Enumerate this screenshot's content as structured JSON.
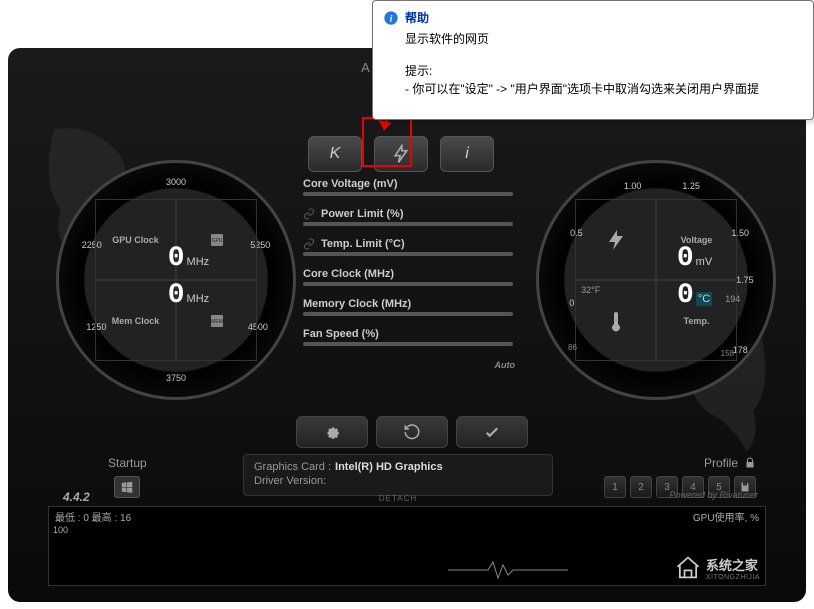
{
  "header": {
    "brand": "A F T E R"
  },
  "tooltip": {
    "title": "帮助",
    "desc": "显示软件的网页",
    "hint_label": "提示:",
    "hint_text": "- 你可以在\"设定\" -> \"用户界面\"选项卡中取消勾选来关闭用户界面提"
  },
  "tabs": {
    "k": "K",
    "i": "i"
  },
  "sliders": {
    "core_voltage": "Core Voltage (mV)",
    "power_limit": "Power Limit (%)",
    "temp_limit": "Temp. Limit (°C)",
    "core_clock": "Core Clock (MHz)",
    "memory_clock": "Memory Clock (MHz)",
    "fan_speed": "Fan Speed (%)",
    "auto": "Auto"
  },
  "gauge_left": {
    "ticks": [
      "1250",
      "2250",
      "3000",
      "3750",
      "4500",
      "5250"
    ],
    "q1_label": "GPU Clock",
    "q1_value": "0",
    "q1_unit": "MHz",
    "q3_label": "Mem Clock",
    "q3_value": "0",
    "q3_unit": "MHz",
    "q4_icon_label": "MEM"
  },
  "gauge_right": {
    "ticks": [
      "0",
      "0.5",
      "1.00",
      "1.25",
      "1.50",
      "1.75",
      "178"
    ],
    "q2_label": "Voltage",
    "q2_value": "0",
    "q2_unit": "mV",
    "q4_label": "Temp.",
    "q4_value": "0",
    "q4_unit": "°C",
    "temp_f": "32°F",
    "temp_sub1": "194",
    "temp_sub2": "158",
    "fan_rpm": "86"
  },
  "startup": {
    "label": "Startup"
  },
  "profile": {
    "label": "Profile",
    "buttons": [
      "1",
      "2",
      "3",
      "4",
      "5"
    ]
  },
  "info": {
    "card_label": "Graphics Card :",
    "card_value": "Intel(R) HD Graphics",
    "driver_label": "Driver Version:",
    "driver_value": "",
    "detach": "DETACH"
  },
  "version": "4.4.2",
  "powered": "Powered by Rivatuner",
  "graph": {
    "left_text": "最低 : 0  最高 : 16",
    "right_text": "GPU使用率, %",
    "y_max": "100"
  },
  "watermark": "系统之家",
  "watermark_sub": "XITONGZHIJIA"
}
